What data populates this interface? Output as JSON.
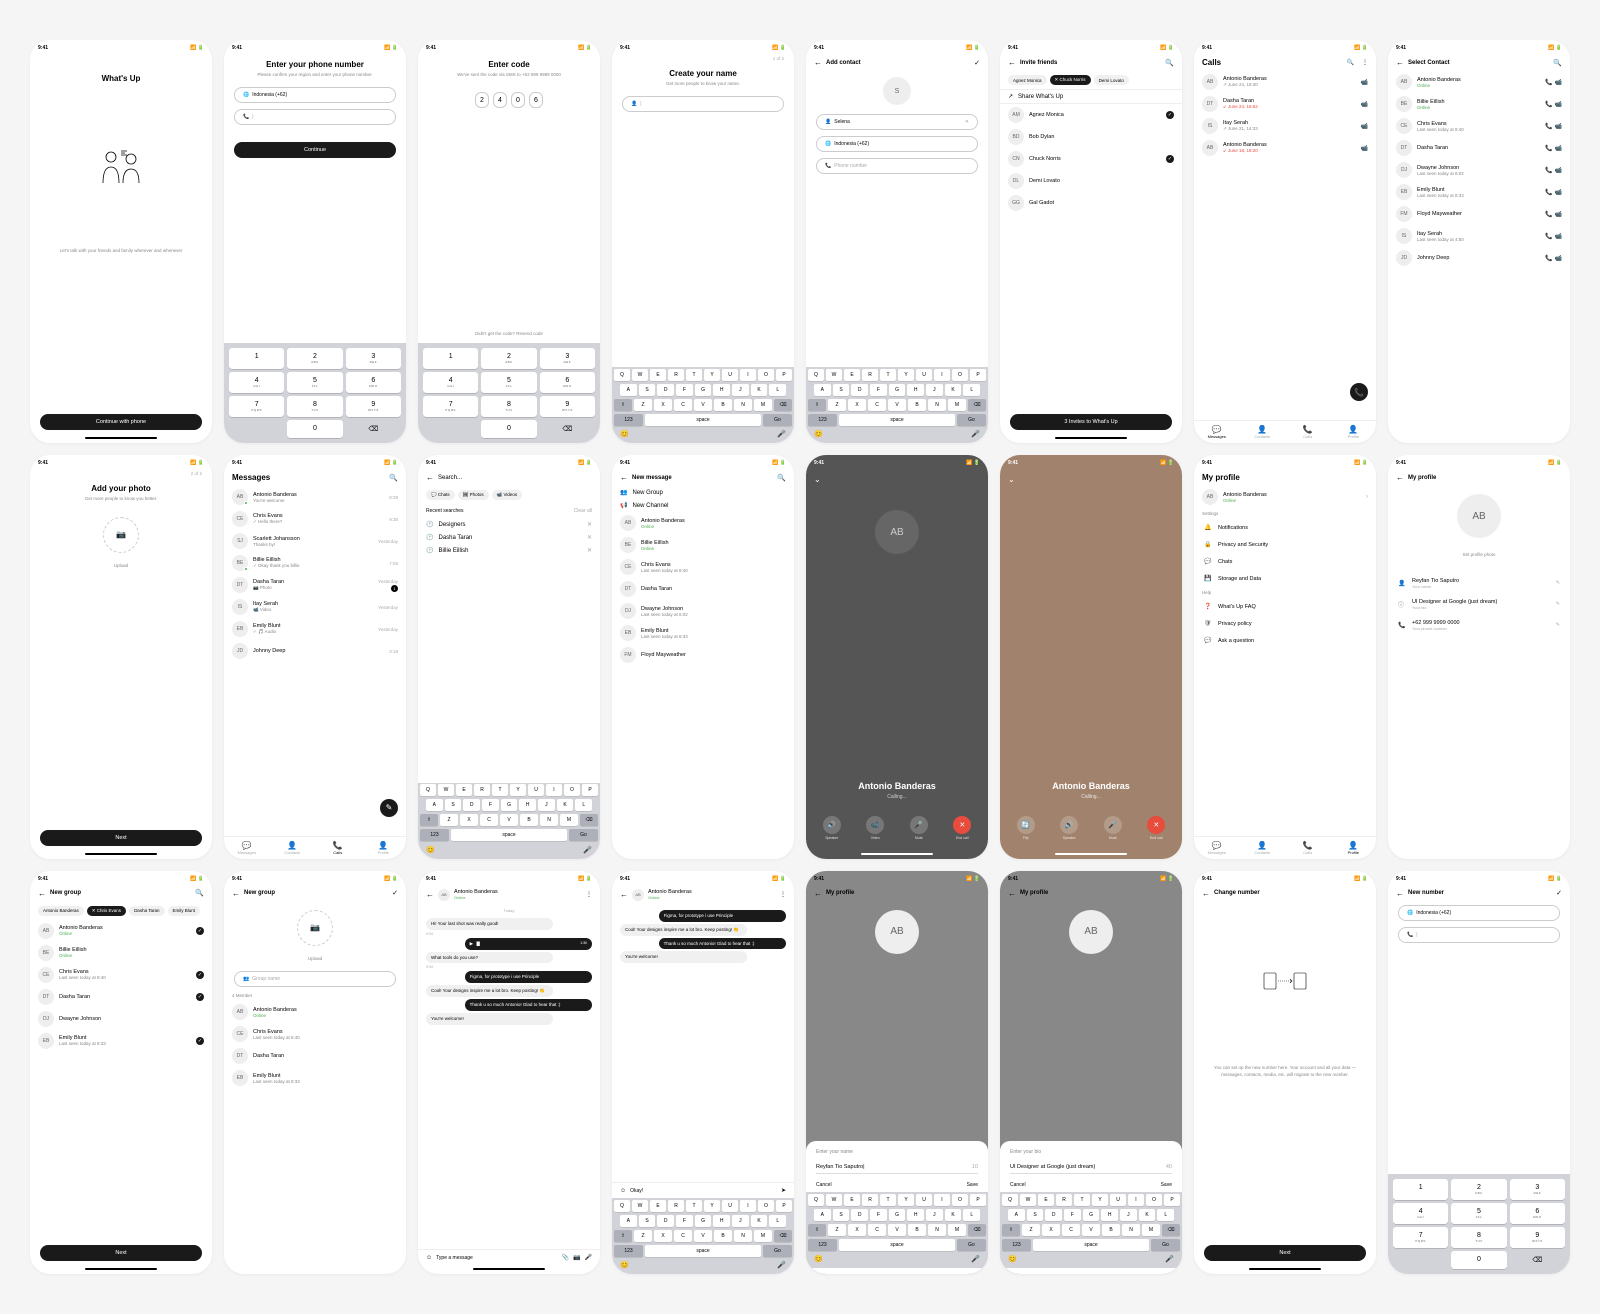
{
  "status_time": "9:41",
  "app_name": "What's Up",
  "tagline": "Let's talk with your friends and family wherever and whenever",
  "btn_continue_phone": "Continue with phone",
  "s2": {
    "title": "Enter your phone number",
    "sub": "Please confirm your region and enter your phone number.",
    "country": "Indonesia (+62)",
    "btn": "Continue"
  },
  "s3": {
    "title": "Enter code",
    "sub": "We've sent the code via SMS to +62 999 9999 0000",
    "digits": [
      "2",
      "4",
      "0",
      "6"
    ],
    "resend": "Didn't get the code? Resend code"
  },
  "s4": {
    "title": "Create your name",
    "sub": "Get more people to know your name.",
    "step": "1 of 2"
  },
  "s5": {
    "title": "Add contact",
    "avatar": "S",
    "name": "Selena",
    "country": "Indonesia (+62)",
    "ph": "Phone number"
  },
  "s6": {
    "title": "Invite friends",
    "chips": [
      "Agnez Monica",
      "Chuck Norris",
      "Demi Lovato"
    ],
    "share": "Share What's Up",
    "contacts": [
      [
        "AM",
        "Agnez Monica",
        true
      ],
      [
        "BD",
        "Bob Dylan",
        false
      ],
      [
        "CN",
        "Chuck Norris",
        true
      ],
      [
        "DL",
        "Demi Lovato",
        false
      ],
      [
        "GG",
        "Gal Gadot",
        false
      ]
    ],
    "btn": "3 Invites to What's Up"
  },
  "s7": {
    "title": "Calls",
    "calls": [
      [
        "AB",
        "Antonio Banderas",
        "↗ June 24, 18:30"
      ],
      [
        "DT",
        "Dasha Taran",
        "↙ June 24, 16:52",
        "red"
      ],
      [
        "IS",
        "Itay Serah",
        "↗ June 21, 14:33"
      ],
      [
        "AB",
        "Antonio Banderas",
        "↙ June 18, 18:20",
        "red"
      ]
    ]
  },
  "s8": {
    "title": "Select Contact",
    "list": [
      [
        "AB",
        "Antonio Banderas",
        "Online",
        "g"
      ],
      [
        "BE",
        "Billie Eillish",
        "Online",
        "g"
      ],
      [
        "CE",
        "Chris Evans",
        "Last seen today at 8:40"
      ],
      [
        "DT",
        "Dasha Taran",
        ""
      ],
      [
        "DJ",
        "Dwayne Johnson",
        "Last seen today at 6:02"
      ],
      [
        "EB",
        "Emily Blunt",
        "Last seen today at 8:33"
      ],
      [
        "FM",
        "Floyd Mayweather",
        ""
      ],
      [
        "IS",
        "Itay Serah",
        "Last seen today at 4:50"
      ],
      [
        "JD",
        "Johnny Deep",
        ""
      ]
    ]
  },
  "s9": {
    "title": "Add your photo",
    "sub": "Get more people to know you better.",
    "step": "2 of 2",
    "upload": "Upload",
    "btn": "Next"
  },
  "s10": {
    "title": "Messages",
    "items": [
      [
        "AB",
        "Antonio Banderas",
        "You're welcome",
        "9:39",
        true
      ],
      [
        "CE",
        "Chris Evans",
        "✓ Hello there?",
        "9:38"
      ],
      [
        "SJ",
        "Scarlett Johansson",
        "Thanks hy!",
        "Yesterday"
      ],
      [
        "BE",
        "Billie Eillish",
        "✓ Okay thank you billie",
        "7:59",
        true
      ],
      [
        "DT",
        "Dasha Taran",
        "📷 Photo",
        "Yesterday",
        false,
        "1"
      ],
      [
        "IS",
        "Itay Serah",
        "📹 Video",
        "Yesterday"
      ],
      [
        "EB",
        "Emily Blunt",
        "✓ 🎵 Audio",
        "Yesterday"
      ],
      [
        "JD",
        "Johnny Deep",
        "",
        "3:18"
      ]
    ]
  },
  "s11": {
    "ph": "Search...",
    "tabs": [
      "Chats",
      "Photos",
      "Videos"
    ],
    "recent": "Recent searches",
    "items": [
      "Designers",
      "Dasha Taran",
      "Billie Eillish"
    ],
    "clear": "Clear all"
  },
  "s12": {
    "title": "New message",
    "menu": [
      "New Group",
      "New Channel"
    ],
    "list": [
      [
        "AB",
        "Antonio Banderas",
        "Online",
        "g"
      ],
      [
        "BE",
        "Billie Eillish",
        "Online",
        "g"
      ],
      [
        "CE",
        "Chris Evans",
        "Last seen today at 8:40"
      ],
      [
        "DT",
        "Dasha Taran",
        ""
      ],
      [
        "DJ",
        "Dwayne Johnson",
        "Last seen today at 6:02"
      ],
      [
        "EB",
        "Emily Blunt",
        "Last seen today at 8:33"
      ],
      [
        "FM",
        "Floyd Mayweather",
        ""
      ]
    ]
  },
  "call": {
    "name": "Antonio Banderas",
    "status": "Calling...",
    "btns": [
      "Speaker",
      "Video",
      "Mute",
      "End call"
    ],
    "btns2": [
      "Flip",
      "Speaker",
      "Mute",
      "End call"
    ]
  },
  "s15": {
    "title": "My profile",
    "name": "Antonio Banderas",
    "status": "Online",
    "settings": "Settings",
    "s_items": [
      "Notifications",
      "Privacy and Security",
      "Chats",
      "Storage and Data"
    ],
    "help": "Help",
    "h_items": [
      "What's Up FAQ",
      "Privacy policy",
      "Ask a question"
    ]
  },
  "s16": {
    "title": "My profile",
    "avatar": "AB",
    "set": "Set profile photo",
    "rows": [
      [
        "Reyfan Tio Saputro",
        "Your name"
      ],
      [
        "UI Designer at Google (just dream)",
        "Your bio"
      ],
      [
        "+62 999 9999 0000",
        "Your phone number"
      ]
    ]
  },
  "s17": {
    "title": "New group",
    "chips": [
      "Antonio Banderas",
      "Chris Evans",
      "Dasha Taran",
      "Emily Blunt"
    ],
    "list": [
      [
        "AB",
        "Antonio Banderas",
        "Online",
        "g",
        true
      ],
      [
        "BE",
        "Billie Eillish",
        "Online",
        "g"
      ],
      [
        "CE",
        "Chris Evans",
        "Last seen today at 8:40",
        null,
        true
      ],
      [
        "DT",
        "Dasha Taran",
        "",
        null,
        true
      ],
      [
        "DJ",
        "Dwayne Johnson",
        ""
      ],
      [
        "EB",
        "Emily Blunt",
        "Last seen today at 8:33",
        null,
        true
      ]
    ],
    "btn": "Next"
  },
  "s18": {
    "title": "New group",
    "upload": "Upload",
    "ph": "Group name",
    "members": "4 Member",
    "list": [
      [
        "AB",
        "Antonio Banderas",
        "Online",
        "g"
      ],
      [
        "CE",
        "Chris Evans",
        "Last seen today at 8:40"
      ],
      [
        "DT",
        "Dasha Taran",
        ""
      ],
      [
        "EB",
        "Emily Blunt",
        "Last seen today at 8:33"
      ]
    ]
  },
  "chat": {
    "name": "Antonio Banderas",
    "status": "Online",
    "today": "Today",
    "msgs": [
      [
        "in",
        "Hi! Your last shot was really good!",
        "9:34"
      ],
      [
        "audio",
        "",
        "1:30"
      ],
      [
        "in",
        "What tools do you use?",
        "9:34"
      ],
      [
        "out",
        "Figma, for prototype i use Principle",
        ""
      ],
      [
        "in",
        "Cool! Your designs inspire me a lot bro. Keep posting! 👏",
        ""
      ],
      [
        "out",
        "Thank u so much Antonio! Glad to hear that :)",
        ""
      ],
      [
        "in",
        "You're welcome!",
        ""
      ]
    ],
    "ph": "Type a message"
  },
  "chat2": {
    "suggest": "Okay!"
  },
  "sheet1": {
    "title": "Enter your name",
    "val": "Reyfan Tio Saputro|",
    "count": "10",
    "cancel": "Cancel",
    "save": "Save"
  },
  "sheet2": {
    "title": "Enter your bio",
    "val": "UI Designer at Google (just dream)",
    "count": "40"
  },
  "s23": {
    "title": "Change number",
    "desc": "You can set up the new number here. Your account and all your data — messages, contacts, media, etc. will migrate to the new number.",
    "btn": "Next"
  },
  "s24": {
    "title": "New number",
    "country": "Indonesia (+62)"
  },
  "tabs": [
    "Messages",
    "Contacts",
    "Calls",
    "Profile"
  ],
  "qwerty": [
    [
      "Q",
      "W",
      "E",
      "R",
      "T",
      "Y",
      "U",
      "I",
      "O",
      "P"
    ],
    [
      "A",
      "S",
      "D",
      "F",
      "G",
      "H",
      "J",
      "K",
      "L"
    ],
    [
      "Z",
      "X",
      "C",
      "V",
      "B",
      "N",
      "M"
    ]
  ],
  "numkeys": [
    [
      "1",
      ""
    ],
    [
      "2",
      "ABC"
    ],
    [
      "3",
      "DEF"
    ],
    [
      "4",
      "GHI"
    ],
    [
      "5",
      "JKL"
    ],
    [
      "6",
      "MNO"
    ],
    [
      "7",
      "PQRS"
    ],
    [
      "8",
      "TUV"
    ],
    [
      "9",
      "WXYZ"
    ]
  ]
}
